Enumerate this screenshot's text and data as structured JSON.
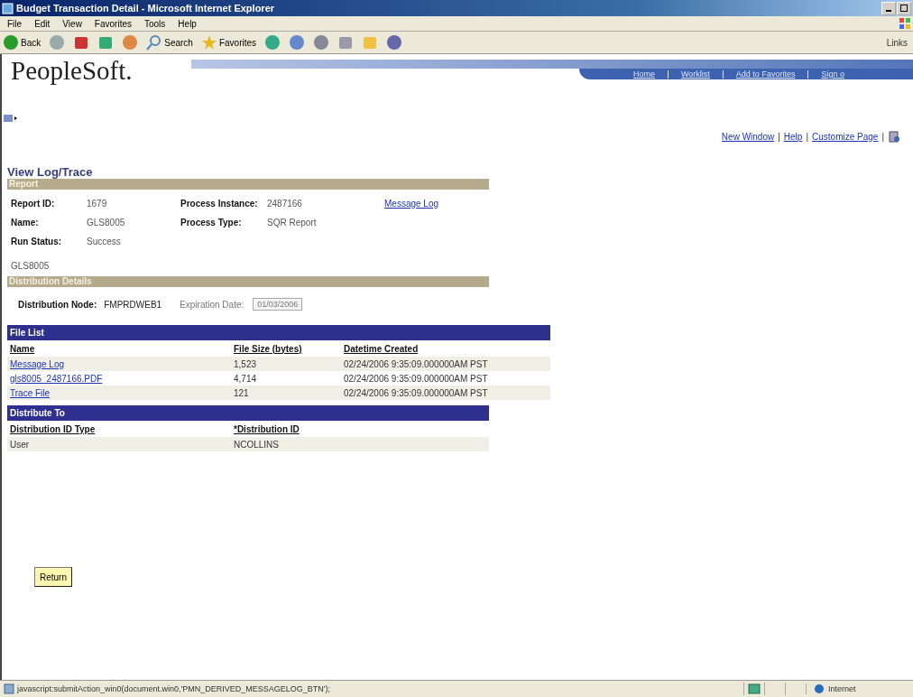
{
  "window": {
    "title": "Budget Transaction Detail - Microsoft Internet Explorer"
  },
  "menu": [
    "File",
    "Edit",
    "View",
    "Favorites",
    "Tools",
    "Help"
  ],
  "toolbar": [
    {
      "kind": "back",
      "label": "Back"
    },
    {
      "kind": "forward"
    },
    {
      "kind": "stop"
    },
    {
      "kind": "refresh"
    },
    {
      "kind": "home"
    },
    {
      "kind": "search",
      "label": "Search"
    },
    {
      "kind": "favorites",
      "label": "Favorites"
    },
    {
      "kind": "history"
    },
    {
      "kind": "mail"
    },
    {
      "kind": "print"
    },
    {
      "kind": "edit"
    },
    {
      "kind": "folder"
    },
    {
      "kind": "messenger"
    }
  ],
  "links_label": "Links",
  "header": {
    "logo": "PeopleSoft.",
    "nav": [
      "Home",
      "Worklist",
      "Add to Favorites",
      "Sign o"
    ]
  },
  "page_links": [
    "New Window",
    "Help",
    "Customize Page"
  ],
  "page_link_separator": "|",
  "page_title": "View Log/Trace",
  "report": {
    "title": "Report",
    "fields": [
      {
        "label": "Report ID:",
        "value": "1679"
      },
      {
        "label": "Process Instance:",
        "value": "2487166"
      },
      {
        "label": "Name:",
        "value": "GLS8005"
      },
      {
        "label": "Process Type:",
        "value": "SQR Report"
      },
      {
        "label": "Run Status:",
        "value": "Success"
      }
    ],
    "link": "Message Log",
    "description": "GLS8005"
  },
  "distribution": {
    "title": "Distribution Details",
    "node_label": "Distribution Node:",
    "node_value": "FMPRDWEB1",
    "expiration_label": "Expiration Date:",
    "expiration_value": "01/03/2006"
  },
  "file_list": {
    "title": "File List",
    "columns": [
      "Name",
      "File Size (bytes)",
      "Datetime Created"
    ],
    "rows": [
      [
        "Message Log",
        "1,523",
        "02/24/2006  9:35:09.000000AM PST"
      ],
      [
        "gls8005_2487166.PDF",
        "4,714",
        "02/24/2006  9:35:09.000000AM PST"
      ],
      [
        "Trace File",
        "121",
        "02/24/2006  9:35:09.000000AM PST"
      ]
    ]
  },
  "distribute_to": {
    "title": "Distribute To",
    "columns": [
      "Distribution ID Type",
      "*Distribution ID"
    ],
    "rows": [
      [
        "User",
        "NCOLLINS"
      ]
    ]
  },
  "return_button": "Return",
  "status_bar": {
    "text": "javascript:submitAction_win0(document.win0,'PMN_DERIVED_MESSAGELOG_BTN');",
    "zone": "Internet"
  }
}
